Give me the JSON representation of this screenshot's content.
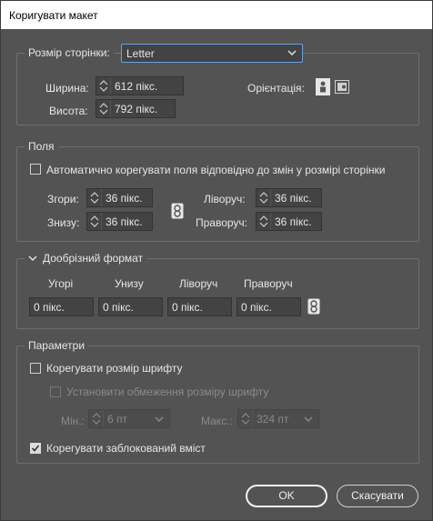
{
  "window": {
    "title": "Коригувати макет"
  },
  "page_size": {
    "legend": "Розмір сторінки:",
    "select_value": "Letter",
    "width_label": "Ширина:",
    "width_value": "612 пікс.",
    "height_label": "Висота:",
    "height_value": "792 пікс.",
    "orientation_label": "Орієнтація:",
    "orientation_icons": [
      "portrait-orientation-icon",
      "landscape-orientation-icon"
    ]
  },
  "margins": {
    "legend": "Поля",
    "auto_adjust_label": "Автоматично корегувати поля відповідно до змін у розмірі сторінки",
    "auto_adjust_checked": false,
    "top_label": "Згори:",
    "top_value": "36 пікс.",
    "bottom_label": "Знизу:",
    "bottom_value": "36 пікс.",
    "left_label": "Ліворуч:",
    "left_value": "36 пікс.",
    "right_label": "Праворуч:",
    "right_value": "36 пікс."
  },
  "bleed": {
    "legend": "Дообрізний формат",
    "top_label": "Угорі",
    "bottom_label": "Унизу",
    "left_label": "Ліворуч",
    "right_label": "Праворуч",
    "top_value": "0 пікс.",
    "bottom_value": "0 пікс.",
    "left_value": "0 пікс.",
    "right_value": "0 пікс."
  },
  "options": {
    "legend": "Параметри",
    "adjust_font_label": "Корегувати розмір шрифту",
    "adjust_font_checked": false,
    "set_limits_label": "Установити обмеження розміру шрифту",
    "set_limits_checked": false,
    "min_label": "Мін.:",
    "min_value": "6 пт",
    "max_label": "Макс.:",
    "max_value": "324 пт",
    "adjust_locked_label": "Корегувати заблокований вміст",
    "adjust_locked_checked": true
  },
  "buttons": {
    "ok": "OK",
    "cancel": "Скасувати"
  }
}
